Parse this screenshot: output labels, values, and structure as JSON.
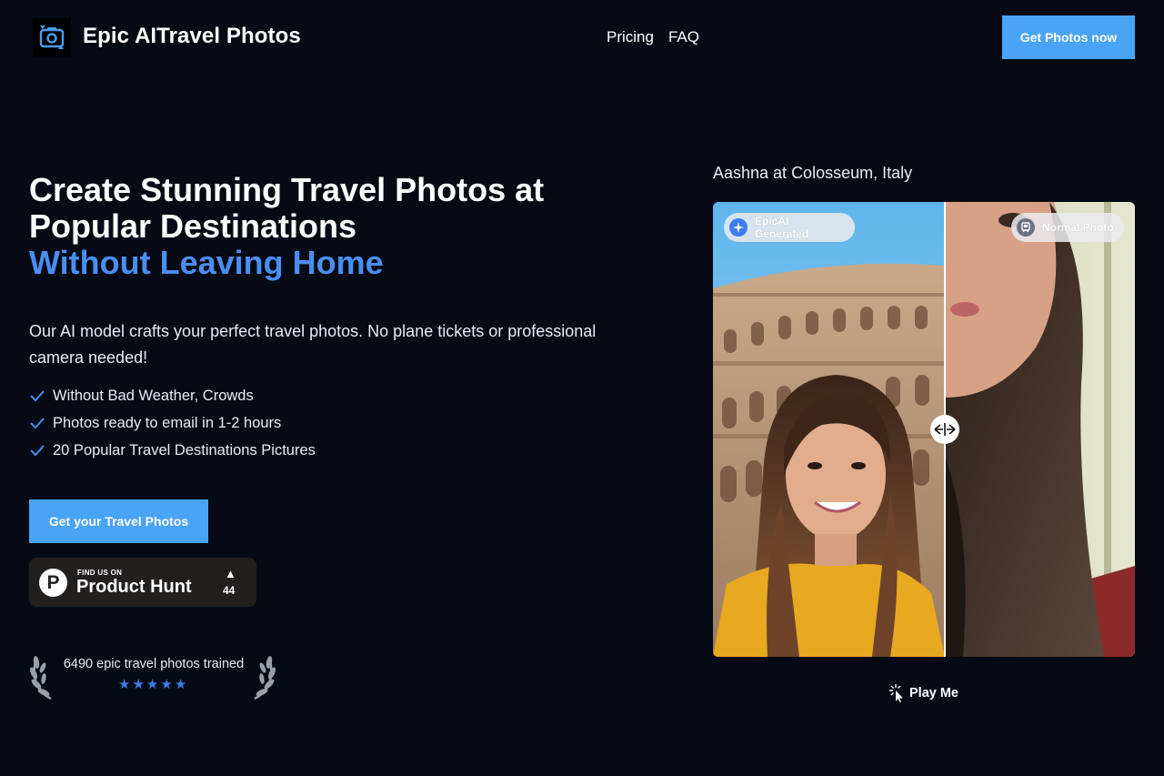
{
  "header": {
    "brand": "Epic AITravel Photos",
    "logo_icon": "camera-rotate-icon",
    "nav": [
      "Pricing",
      "FAQ"
    ],
    "cta": "Get Photos now"
  },
  "hero": {
    "title_line1": "Create Stunning Travel Photos at",
    "title_line2": "Popular Destinations",
    "title_accent": "Without Leaving Home",
    "lead": "Our AI model crafts your perfect travel photos. No plane tickets or professional camera needed!",
    "features": [
      "Without Bad Weather, Crowds",
      "Photos ready to email in 1-2 hours",
      "20 Popular Travel Destinations Pictures"
    ],
    "cta": "Get your Travel Photos",
    "product_hunt": {
      "small": "FIND US ON",
      "big": "Product Hunt",
      "logo_letter": "P",
      "arrow": "▲",
      "count": "44"
    },
    "trained_text": "6490 epic travel photos trained",
    "rating": 5
  },
  "comparison": {
    "caption": "Aashna at Colosseum, Italy",
    "left_label": "EpicAI Generated",
    "right_label": "Normal Photo",
    "play_label": "Play Me"
  },
  "colors": {
    "background": "#050a14",
    "accent_blue": "#4aa3f5",
    "heading_accent": "#4a8ef0",
    "star": "#3d7df0"
  }
}
